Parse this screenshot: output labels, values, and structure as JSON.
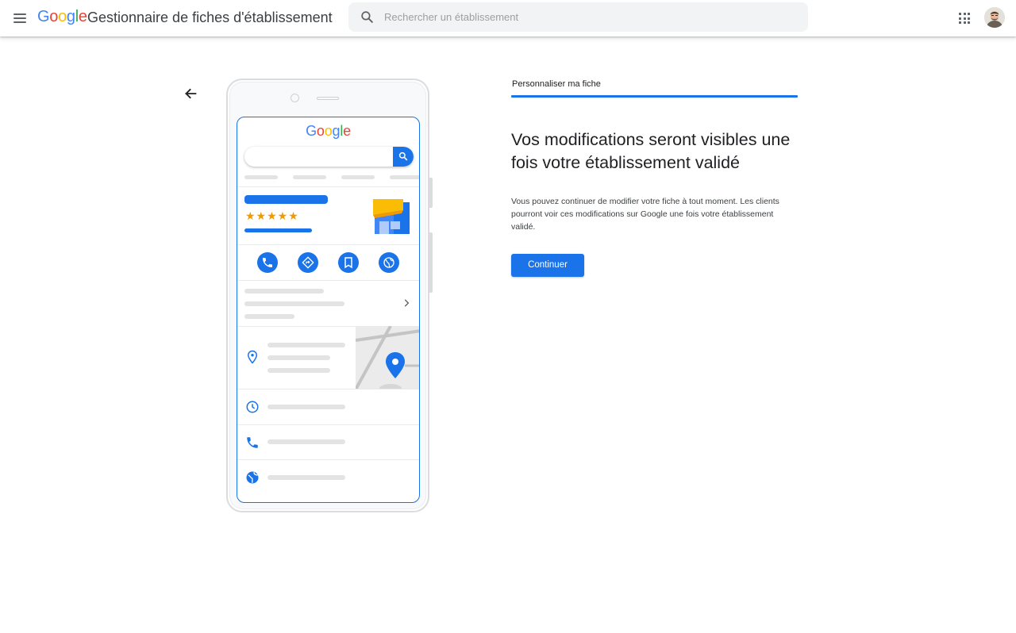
{
  "header": {
    "logo_letters": [
      "G",
      "o",
      "o",
      "g",
      "l",
      "e"
    ],
    "app_title": "Gestionnaire de fiches d'établissement",
    "search_placeholder": "Rechercher un établissement"
  },
  "illustration": {
    "logo_letters": [
      "G",
      "o",
      "o",
      "g",
      "l",
      "e"
    ],
    "stars": "★★★★★"
  },
  "panel": {
    "tab_label": "Personnaliser ma fiche",
    "headline": "Vos modifications seront visibles une fois votre établissement validé",
    "body": "Vous pouvez continuer de modifier votre fiche à tout moment. Les clients pourront voir ces modifications sur Google une fois votre établissement validé.",
    "button_label": "Continuer"
  },
  "colors": {
    "accent": "#1a73e8",
    "google_blue": "#4285f4",
    "google_red": "#ea4335",
    "google_yellow": "#fbbc05",
    "google_green": "#34a853",
    "star": "#f29900"
  }
}
